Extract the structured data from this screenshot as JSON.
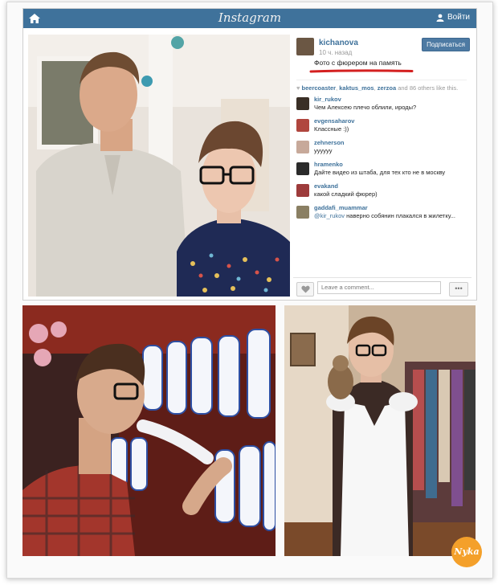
{
  "header": {
    "brand": "Instagram",
    "login_label": "Войти"
  },
  "post": {
    "username": "kichanova",
    "time": "10 ч. назад",
    "caption": "Фото с фюрером на память",
    "follow_label": "Подписаться",
    "likes": {
      "users": [
        "beercoaster",
        "kaktus_mos",
        "zerzoa"
      ],
      "rest": "and 86 others like this."
    },
    "comments": [
      {
        "user": "kir_rukov",
        "text": "Чем Алексею плечо облили, ироды?",
        "color": "#3a2f26"
      },
      {
        "user": "evgensaharov",
        "text": "Классные :))",
        "color": "#b0463e"
      },
      {
        "user": "zehnerson",
        "text": "уууууу",
        "color": "#c7a99a"
      },
      {
        "user": "hramenko",
        "text": "Дайте видео из штаба, для тех кто не в москву",
        "color": "#2b2b2b"
      },
      {
        "user": "evakand",
        "text": "какой сладкий фюрер)",
        "color": "#9d3b3b"
      },
      {
        "user": "gaddafi_muammar",
        "mention": "@kir_rukov",
        "text": "наверно собянин плакался в жилетку...",
        "color": "#8a7f63"
      }
    ],
    "comment_placeholder": "Leave a comment...",
    "more_label": "•••"
  },
  "watermark": {
    "logo_text": "Nyka"
  },
  "colors": {
    "instagram_blue": "#3f729b",
    "highlight_red": "#d42020"
  }
}
